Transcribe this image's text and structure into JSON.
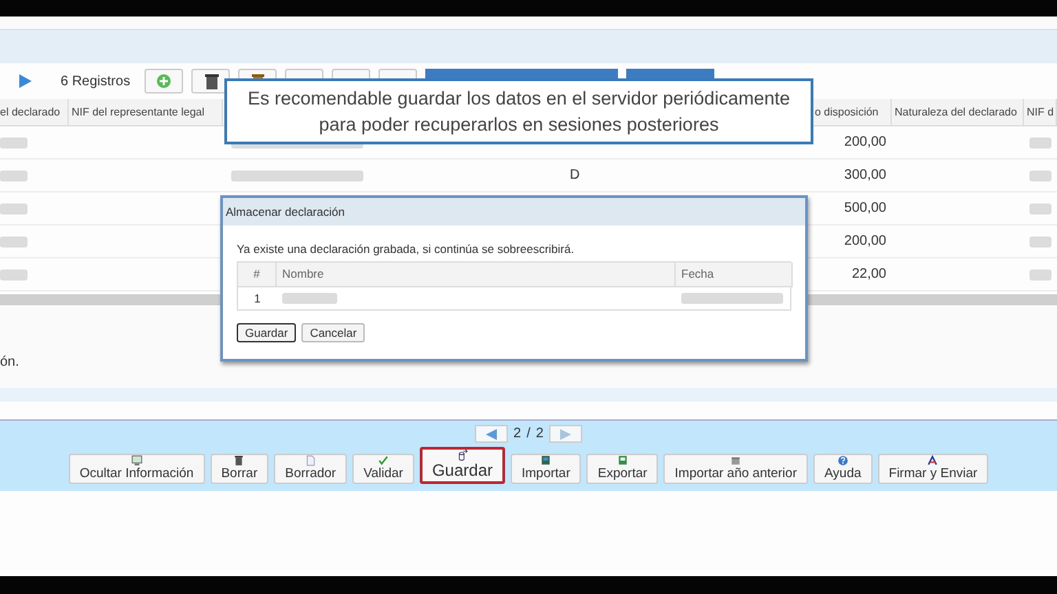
{
  "toolbar": {
    "record_count": "6 Registros"
  },
  "table": {
    "columns": [
      "el declarado",
      "NIF del representante legal",
      "",
      "o disposición",
      "Naturaleza del declarado",
      "NIF d"
    ],
    "rows": [
      {
        "flag": "",
        "amount": "200,00"
      },
      {
        "flag": "D",
        "amount": "300,00"
      },
      {
        "flag": "",
        "amount": "500,00"
      },
      {
        "flag": "",
        "amount": "200,00"
      },
      {
        "flag": "",
        "amount": "22,00"
      }
    ]
  },
  "footer_text": "ón.",
  "tooltip": {
    "text": "Es recomendable guardar los datos en el servidor periódicamente para poder recuperarlos en sesiones posteriores"
  },
  "dialog": {
    "title": "Almacenar declaración",
    "message": "Ya existe una declaración grabada, si continúa se sobreescribirá.",
    "columns": [
      "#",
      "Nombre",
      "Fecha"
    ],
    "rows": [
      {
        "index": "1"
      }
    ],
    "buttons": [
      {
        "label": "Guardar",
        "focused": true
      },
      {
        "label": "Cancelar",
        "focused": false
      }
    ]
  },
  "pager": {
    "current": "2",
    "separator": "/",
    "total": "2"
  },
  "actions": [
    {
      "label": "Ocultar Información",
      "selected": false
    },
    {
      "label": "Borrar",
      "selected": false
    },
    {
      "label": "Borrador",
      "selected": false
    },
    {
      "label": "Validar",
      "selected": false
    },
    {
      "label": "Guardar",
      "selected": true
    },
    {
      "label": "Importar",
      "selected": false
    },
    {
      "label": "Exportar",
      "selected": false
    },
    {
      "label": "Importar año anterior",
      "selected": false
    },
    {
      "label": "Ayuda",
      "selected": false
    },
    {
      "label": "Firmar y Enviar",
      "selected": false
    }
  ]
}
